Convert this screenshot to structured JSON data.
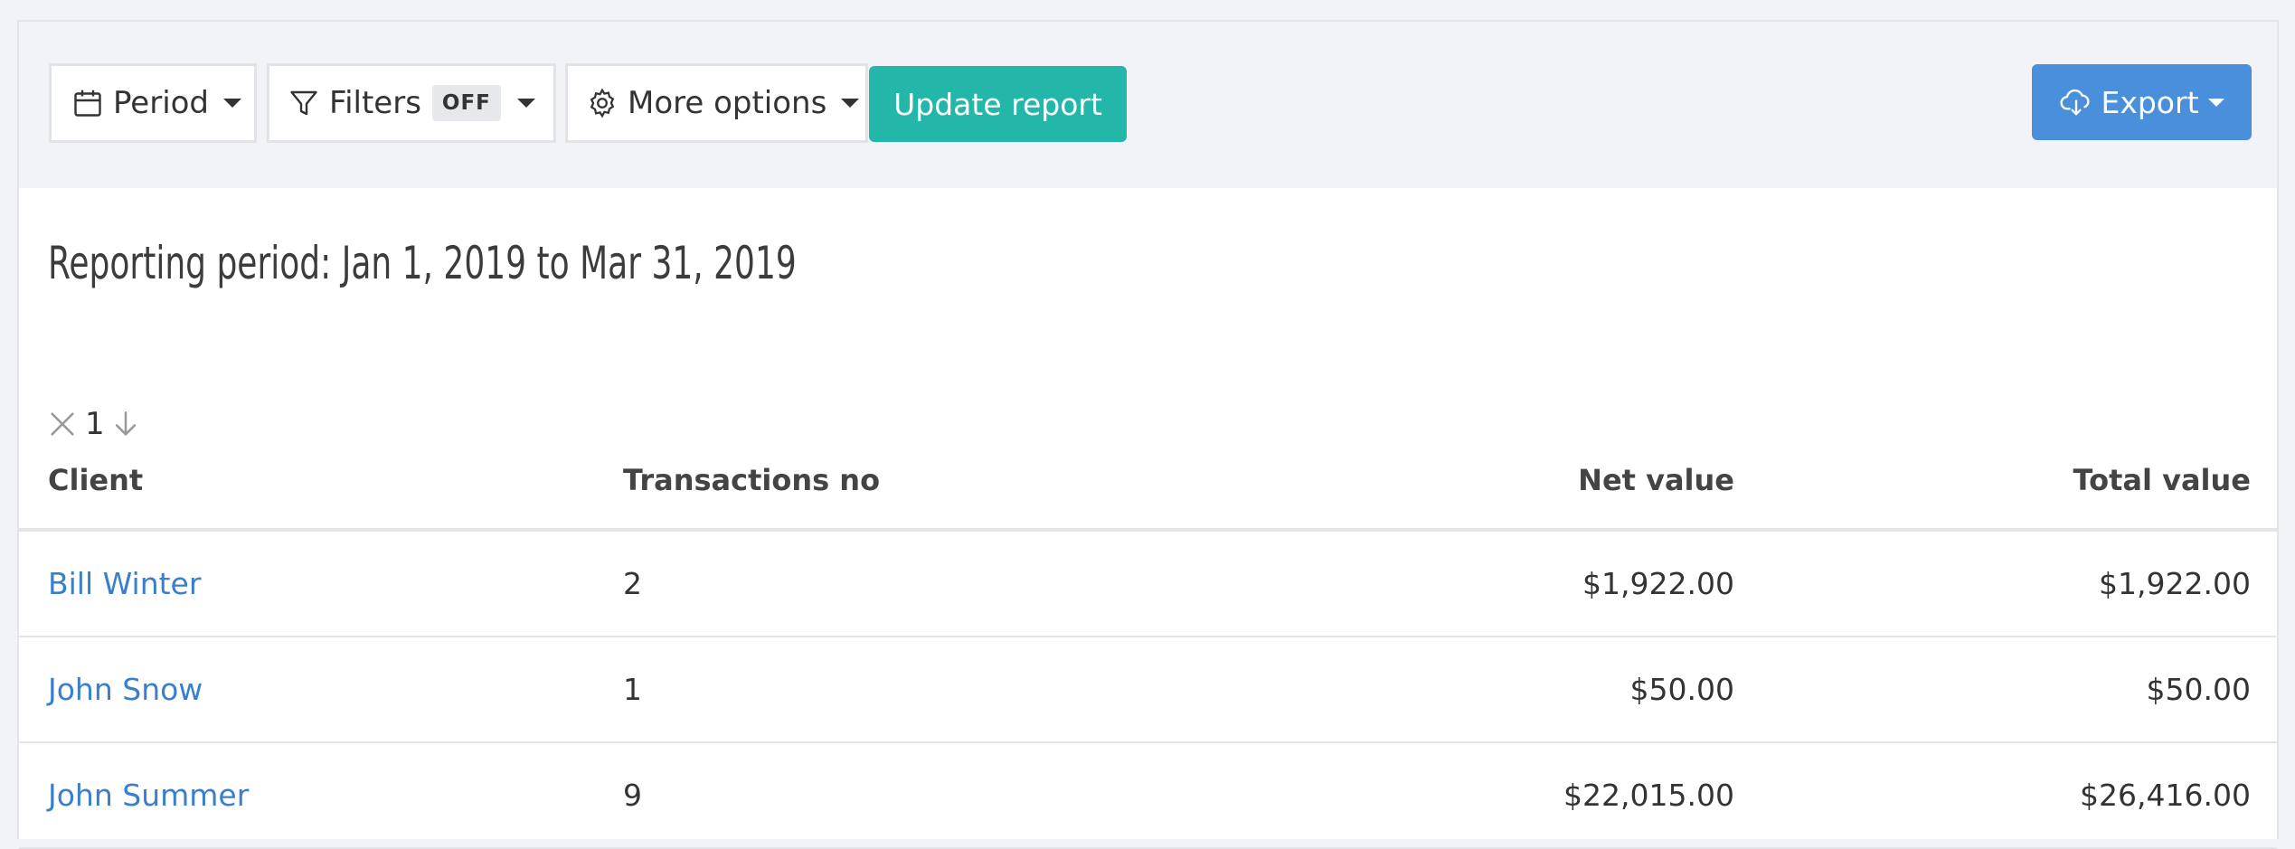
{
  "toolbar": {
    "period_label": "Period",
    "filters_label": "Filters",
    "filters_badge": "OFF",
    "more_options_label": "More options",
    "update_label": "Update report",
    "export_label": "Export",
    "icons": {
      "period": "calendar-icon",
      "filters": "filter-icon",
      "more_options": "gear-icon",
      "export": "cloud-download-icon"
    }
  },
  "report": {
    "title": "Reporting period: Jan 1, 2019 to Mar 31, 2019"
  },
  "sort": {
    "index": "1"
  },
  "table": {
    "columns": [
      "Client",
      "Transactions no",
      "Net value",
      "Total value"
    ],
    "rows": [
      {
        "client": "Bill Winter",
        "transactions": "2",
        "net": "$1,922.00",
        "total": "$1,922.00"
      },
      {
        "client": "John Snow",
        "transactions": "1",
        "net": "$50.00",
        "total": "$50.00"
      },
      {
        "client": "John Summer",
        "transactions": "9",
        "net": "$22,015.00",
        "total": "$26,416.00"
      }
    ]
  },
  "colors": {
    "accent_teal": "#23b7a9",
    "accent_blue": "#4a8fdb",
    "link": "#3a7fcd"
  }
}
